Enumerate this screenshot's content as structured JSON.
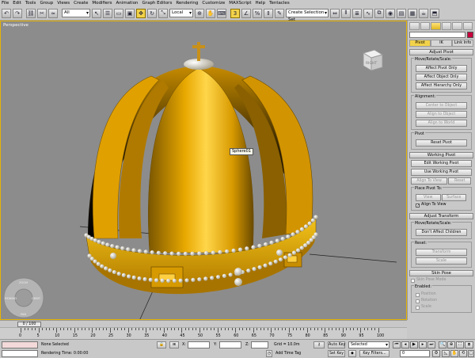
{
  "menu": [
    "File",
    "Edit",
    "Tools",
    "Group",
    "Views",
    "Create",
    "Modifiers",
    "Animation",
    "Graph Editors",
    "Rendering",
    "Customize",
    "MAXScript",
    "Help",
    "Tentacles"
  ],
  "toolbar": {
    "filter": "All",
    "coord": "Local",
    "selection_set": "Create Selection Set"
  },
  "viewport": {
    "label": "Perspective",
    "object_label": "Sphere01",
    "viewcube_face": "RIGHT",
    "wheel_labels": [
      "ZOOM",
      "ORBIT",
      "PAN",
      "REWIND"
    ]
  },
  "cmd": {
    "tabs": [
      "Pivot",
      "IK",
      "Link Info"
    ],
    "adjust_pivot": {
      "title": "Adjust Pivot",
      "group1": "Move/Rotate/Scale:",
      "b1": "Affect Pivot Only",
      "b2": "Affect Object Only",
      "b3": "Affect Hierarchy Only",
      "group2": "Alignment:",
      "b4": "Center to Object",
      "b5": "Align to Object",
      "b6": "Align to World",
      "group3": "Pivot",
      "b7": "Reset Pivot"
    },
    "working_pivot": {
      "title": "Working Pivot",
      "b1": "Edit Working Pivot",
      "b2": "Use Working Pivot",
      "b3": "Align To View",
      "b4": "Reset",
      "group": "Place Pivot To:",
      "b5": "View",
      "b6": "Surface",
      "chk": "Align To View"
    },
    "adjust_transform": {
      "title": "Adjust Transform",
      "group1": "Move/Rotate/Scale:",
      "b1": "Don't Affect Children",
      "group2": "Reset:",
      "b2": "Transform",
      "b3": "Scale"
    },
    "skin_pose": {
      "title": "Skin Pose",
      "chk": "Skin Pose Mode",
      "group": "Enabled:",
      "c1": "Position",
      "c2": "Rotation",
      "c3": "Scale"
    }
  },
  "time": {
    "slider": "0 / 100",
    "ticks": [
      "0",
      "5",
      "10",
      "15",
      "20",
      "25",
      "30",
      "35",
      "40",
      "45",
      "50",
      "55",
      "60",
      "65",
      "70",
      "75",
      "80",
      "85",
      "90",
      "95",
      "100"
    ]
  },
  "status": {
    "selection": "None Selected",
    "prompt": "Rendering Time: 0:00:00",
    "x_label": "X:",
    "y_label": "Y:",
    "z_label": "Z:",
    "grid": "Grid = 10.0m",
    "add_time_tag": "Add Time Tag",
    "auto_key": "Auto Key",
    "set_key": "Set Key",
    "key_mode": "Selected",
    "key_filters": "Key Filters...",
    "frame": "0"
  }
}
